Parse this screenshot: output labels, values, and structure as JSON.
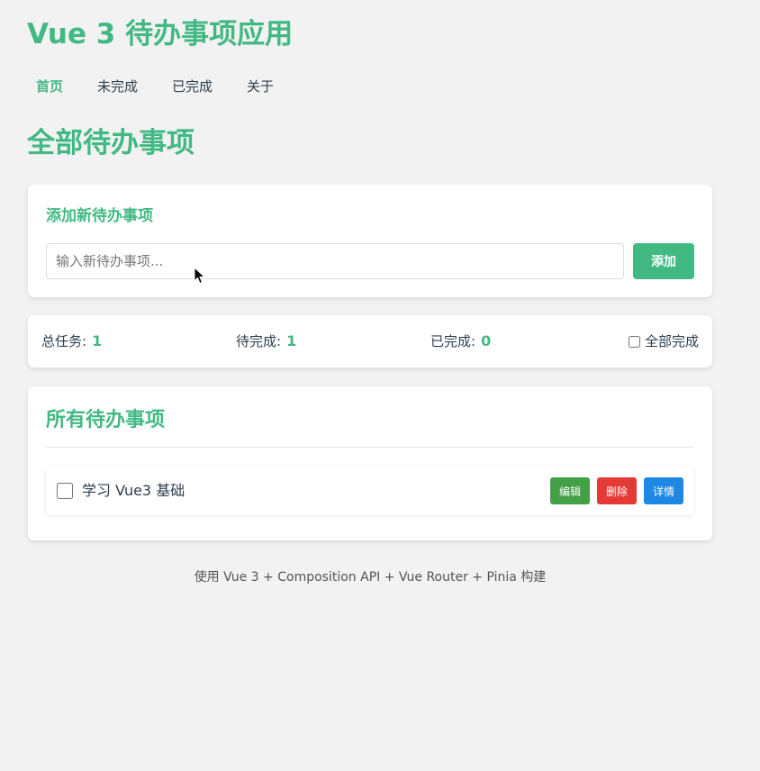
{
  "app": {
    "title": "Vue 3 待办事项应用"
  },
  "nav": {
    "items": [
      {
        "label": "首页",
        "active": true
      },
      {
        "label": "未完成",
        "active": false
      },
      {
        "label": "已完成",
        "active": false
      },
      {
        "label": "关于",
        "active": false
      }
    ]
  },
  "page": {
    "title": "全部待办事项"
  },
  "add_form": {
    "title": "添加新待办事项",
    "input_value": "",
    "input_placeholder": "输入新待办事项...",
    "button_label": "添加"
  },
  "stats": {
    "total_label": "总任务:",
    "total_value": "1",
    "pending_label": "待完成:",
    "pending_value": "1",
    "done_label": "已完成:",
    "done_value": "0",
    "complete_all_label": "全部完成",
    "complete_all_checked": false
  },
  "todo_list": {
    "title": "所有待办事项",
    "items": [
      {
        "text": "学习 Vue3 基础",
        "completed": false,
        "edit_label": "编辑",
        "delete_label": "删除",
        "details_label": "详情"
      }
    ]
  },
  "footer": {
    "text": "使用 Vue 3 + Composition API + Vue Router + Pinia 构建"
  },
  "colors": {
    "accent": "#42b983",
    "edit_button": "#43a047",
    "delete_button": "#e53935",
    "details_button": "#1e88e5",
    "background": "#f2f2f2"
  },
  "icons": {
    "cursor": "mouse-pointer-icon"
  }
}
